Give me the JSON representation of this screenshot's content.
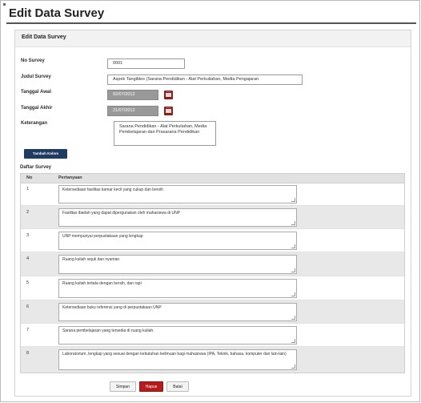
{
  "window": {
    "title": "Edit Data Survey"
  },
  "panel": {
    "title": "Edit Data Survey"
  },
  "form": {
    "no_survey": {
      "label": "No Survey",
      "value": "0001"
    },
    "judul": {
      "label": "Judul Survey",
      "value": "Aspek Tangibles (Sarana Pendidikan - Alat Perkuliahan, Media Pengajaran"
    },
    "tanggal_awal": {
      "label": "Tanggal Awal",
      "value": "02/07/2012"
    },
    "tanggal_akhir": {
      "label": "Tanggal Akhir",
      "value": "21/07/2012"
    },
    "keterangan": {
      "label": "Keterangan",
      "value": "Sarana Pendidikan - Alat Perkuliahan, Media Pembelajaran dan Prasarana Pendidikan"
    }
  },
  "add_button": "Tambah Kolom",
  "daftar": {
    "title": "Daftar Survey",
    "columns": [
      "No",
      "Pertanyaan"
    ],
    "rows": [
      {
        "no": "1",
        "q": "Ketersediaan fasilitas kamar kecil yang cukup dan bersih"
      },
      {
        "no": "2",
        "q": "Fasilitas ibadah yang dapat dipergunakan oleh mahasiswa di UNP"
      },
      {
        "no": "3",
        "q": "UNP mempunyai perpustakaan yang lengkap"
      },
      {
        "no": "4",
        "q": "Ruang kuliah sejuk dan nyaman"
      },
      {
        "no": "5",
        "q": "Ruang kuliah tertata dengan bersih, dan rapi"
      },
      {
        "no": "6",
        "q": "Ketersediaan buku referensi yang di perpustakaan UNP"
      },
      {
        "no": "7",
        "q": "Sarana pembelajaran yang tersedia di ruang kuliah."
      },
      {
        "no": "8",
        "q": "Laboratorium, lengkap yang sesuai dengan kebutuhan keilmuan bagi mahasiswa (IPA, Teknik, bahasa, komputer dan lain-lain)"
      }
    ]
  },
  "buttons": {
    "save": "Simpan",
    "delete": "Hapus",
    "cancel": "Batal"
  },
  "colors": {
    "primary": "#1f3b61",
    "danger": "#b71c1c",
    "calendar": "#8b1d1d"
  }
}
